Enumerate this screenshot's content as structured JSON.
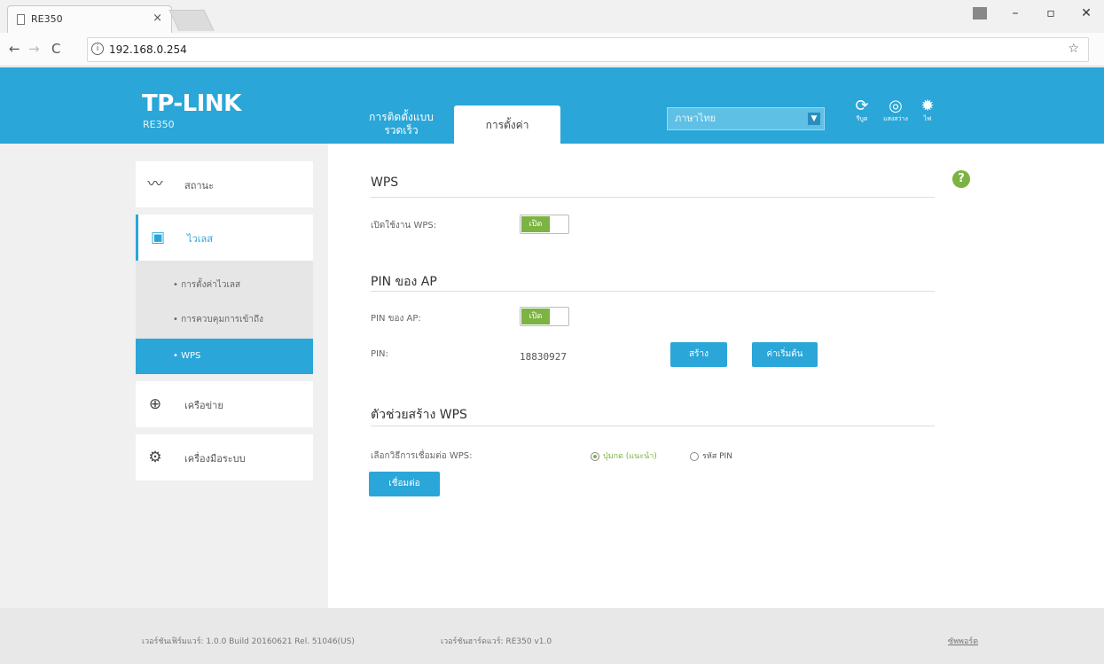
{
  "browser": {
    "tab_title": "RE350",
    "tab_close": "×",
    "url": "192.168.0.254",
    "info_icon": "i",
    "star_icon": "☆",
    "menu_icon": "⋮",
    "minimize": "–",
    "maximize": "▫",
    "close": "✕"
  },
  "header": {
    "logo": "TP-LINK",
    "model": "RE350",
    "quick_setup": "การติดตั้งแบบรวดเร็ว",
    "settings_tab": "การตั้งค่า",
    "language": "ภาษาไทย",
    "icons": [
      {
        "name": "reboot-icon",
        "glyph": "⟳",
        "label": "รีบูต"
      },
      {
        "name": "led-icon",
        "glyph": "◎",
        "label": "แสงสว่าง"
      },
      {
        "name": "led-light-icon",
        "glyph": "✹",
        "label": "ไฟ"
      }
    ],
    "bg_color": "#2aa6d8"
  },
  "sidebar": {
    "items": [
      {
        "label": "สถานะ",
        "icon": "status-icon"
      },
      {
        "label": "ไวเลส",
        "icon": "wireless-icon"
      },
      {
        "label": "เครือข่าย",
        "icon": "network-icon"
      },
      {
        "label": "เครื่องมือระบบ",
        "icon": "system-tools-icon"
      }
    ],
    "sub_items": [
      {
        "label": "•  การตั้งค่าไวเลส"
      },
      {
        "label": "•  การควบคุมการเข้าถึง"
      },
      {
        "label": "•  WPS"
      }
    ]
  },
  "main": {
    "wps_title": "WPS",
    "wps_enable_label": "เปิดใช้งาน WPS:",
    "toggle_on": "เปิด",
    "pin_title": "PIN ของ AP",
    "pin_label": "PIN ของ AP:",
    "pin_field_label": "PIN:",
    "pin_value": "18830927",
    "generate_btn": "สร้าง",
    "default_btn": "ค่าเริ่มต้น",
    "wizard_title": "ตัวช่วยสร้าง WPS",
    "method_label": "เลือกวิธีการเชื่อมต่อ WPS:",
    "radio_pbc": "ปุ่มกด (แนะนำ)",
    "radio_pin": "รหัส PIN",
    "connect_btn": "เชื่อมต่อ",
    "help": "?"
  },
  "footer": {
    "firmware": "เวอร์ชันเฟิร์มแวร์: 1.0.0 Build 20160621 Rel. 51046(US)",
    "hardware": "เวอร์ชันฮาร์ดแวร์: RE350 v1.0",
    "support": "ซัพพอร์ต"
  }
}
